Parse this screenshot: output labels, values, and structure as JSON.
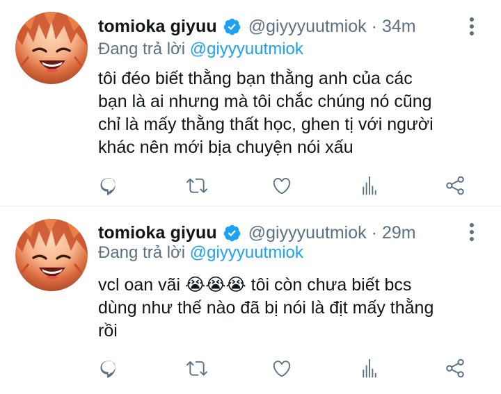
{
  "tweets": [
    {
      "display_name": "tomioka giyuu",
      "handle": "@giyyyuutmiok",
      "separator": "·",
      "time": "34m",
      "replying_prefix": "Đang trả lời",
      "replying_to": "@giyyyuutmiok",
      "text": "tôi đéo biết thằng bạn thằng anh của các\nbạn là ai nhưng mà tôi chắc chúng nó cũng\nchỉ là mấy thằng thất học, ghen tị với người\nkhác nên mới bịa chuyện nói xấu"
    },
    {
      "display_name": "tomioka giyuu",
      "handle": "@giyyyuutmiok",
      "separator": "·",
      "time": "29m",
      "replying_prefix": "Đang trả lời",
      "replying_to": "@giyyyuutmiok",
      "text": "vcl oan vãi 😭😭😭 tôi còn chưa biết bcs\ndùng như thế nào đã bị nói là địt mấy thằng\nrồi"
    }
  ],
  "icons": {
    "verified": "verified-badge-icon",
    "more": "more-vertical-icon",
    "reply": "reply-icon",
    "retweet": "retweet-icon",
    "like": "heart-icon",
    "stats": "analytics-icon",
    "share": "share-icon"
  },
  "colors": {
    "accent": "#1da1f2",
    "secondary_text": "#5b7083",
    "text": "#0f1419",
    "divider": "#e6ecf0"
  }
}
